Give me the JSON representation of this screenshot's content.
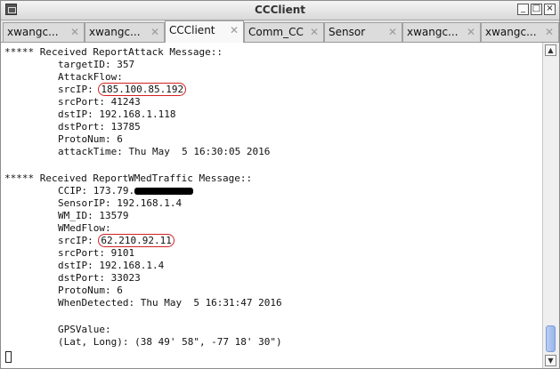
{
  "window": {
    "title": "CCClient"
  },
  "tabs": [
    {
      "label": "xwangc..."
    },
    {
      "label": "xwangc..."
    },
    {
      "label": "CCClient"
    },
    {
      "label": "Comm_CC"
    },
    {
      "label": "Sensor"
    },
    {
      "label": "xwangc..."
    },
    {
      "label": "xwangc..."
    }
  ],
  "terminal": {
    "report1": {
      "header": "***** Received ReportAttack Message::",
      "targetID": "targetID: 357",
      "attackFlow": "AttackFlow:",
      "srcIP_label": "srcIP: ",
      "srcIP_value": "185.100.85.192",
      "srcPort": "srcPort: 41243",
      "dstIP": "dstIP: 192.168.1.118",
      "dstPort": "dstPort: 13785",
      "protoNum": "ProtoNum: 6",
      "attackTime": "attackTime: Thu May  5 16:30:05 2016"
    },
    "report2": {
      "header": "***** Received ReportWMedTraffic Message::",
      "ccip_label": "CCIP: 173.79.",
      "sensorIP": "SensorIP: 192.168.1.4",
      "wmID": "WM_ID: 13579",
      "wmedFlow": "WMedFlow:",
      "srcIP_label": "srcIP: ",
      "srcIP_value": "62.210.92.11",
      "srcPort": "srcPort: 9101",
      "dstIP": "dstIP: 192.168.1.4",
      "dstPort": "dstPort: 33023",
      "protoNum": "ProtoNum: 6",
      "whenDetected": "WhenDetected: Thu May  5 16:31:47 2016",
      "gpsValue": "GPSValue:",
      "latLong": "(Lat, Long): (38 49' 58\", -77 18' 30\")"
    }
  }
}
